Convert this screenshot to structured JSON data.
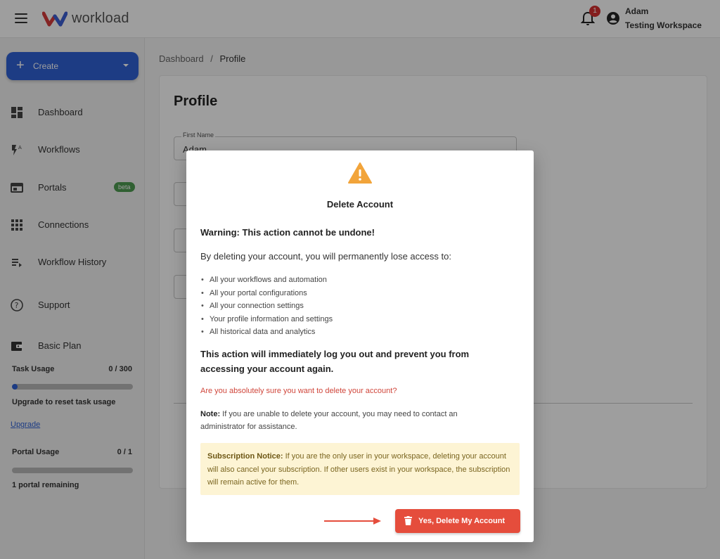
{
  "header": {
    "brand": "workload",
    "notification_count": "1",
    "user_name": "Adam",
    "workspace_name": "Testing Workspace"
  },
  "sidebar": {
    "create_label": "Create",
    "items": [
      {
        "label": "Dashboard",
        "icon": "dashboard-icon"
      },
      {
        "label": "Workflows",
        "icon": "workflows-icon"
      },
      {
        "label": "Portals",
        "icon": "portals-icon",
        "badge": "beta"
      },
      {
        "label": "Connections",
        "icon": "connections-icon"
      },
      {
        "label": "Workflow History",
        "icon": "workflow-history-icon"
      },
      {
        "label": "Support",
        "icon": "support-icon"
      },
      {
        "label": "Basic Plan",
        "icon": "wallet-icon"
      }
    ],
    "task_usage": {
      "title": "Task Usage",
      "value": "0 / 300",
      "fraction": 0.0
    },
    "upgrade_note": "Upgrade to reset task usage",
    "upgrade_link": "Upgrade",
    "portal_usage": {
      "title": "Portal Usage",
      "value": "0 / 1",
      "fraction": 0.0
    },
    "portal_remaining": "1 portal remaining"
  },
  "main": {
    "breadcrumb": {
      "parent": "Dashboard",
      "separator": "/",
      "current": "Profile"
    },
    "title": "Profile",
    "first_name": {
      "label": "First Name",
      "value": "Adam"
    }
  },
  "modal": {
    "title": "Delete Account",
    "warning": "Warning: This action cannot be undone!",
    "lead": "By deleting your account, you will permanently lose access to:",
    "items": [
      "All your workflows and automation",
      "All your portal configurations",
      "All your connection settings",
      "Your profile information and settings",
      "All historical data and analytics"
    ],
    "strong_text": "This action will immediately log you out and prevent you from accessing your account again.",
    "confirm_question": "Are you absolutely sure you want to delete your account?",
    "note_label": "Note:",
    "note_text": "If you are unable to delete your account, you may need to contact an administrator for assistance.",
    "notice_label": "Subscription Notice:",
    "notice_text": "If you are the only user in your workspace, deleting your account will also cancel your subscription. If other users exist in your workspace, the subscription will remain active for them.",
    "delete_button": "Yes, Delete My Account"
  },
  "colors": {
    "primary": "#2f62d6",
    "danger": "#e54d3c",
    "warning": "#f2a43a",
    "notice_bg": "#fdf4d4",
    "beta": "#4e9b51"
  }
}
